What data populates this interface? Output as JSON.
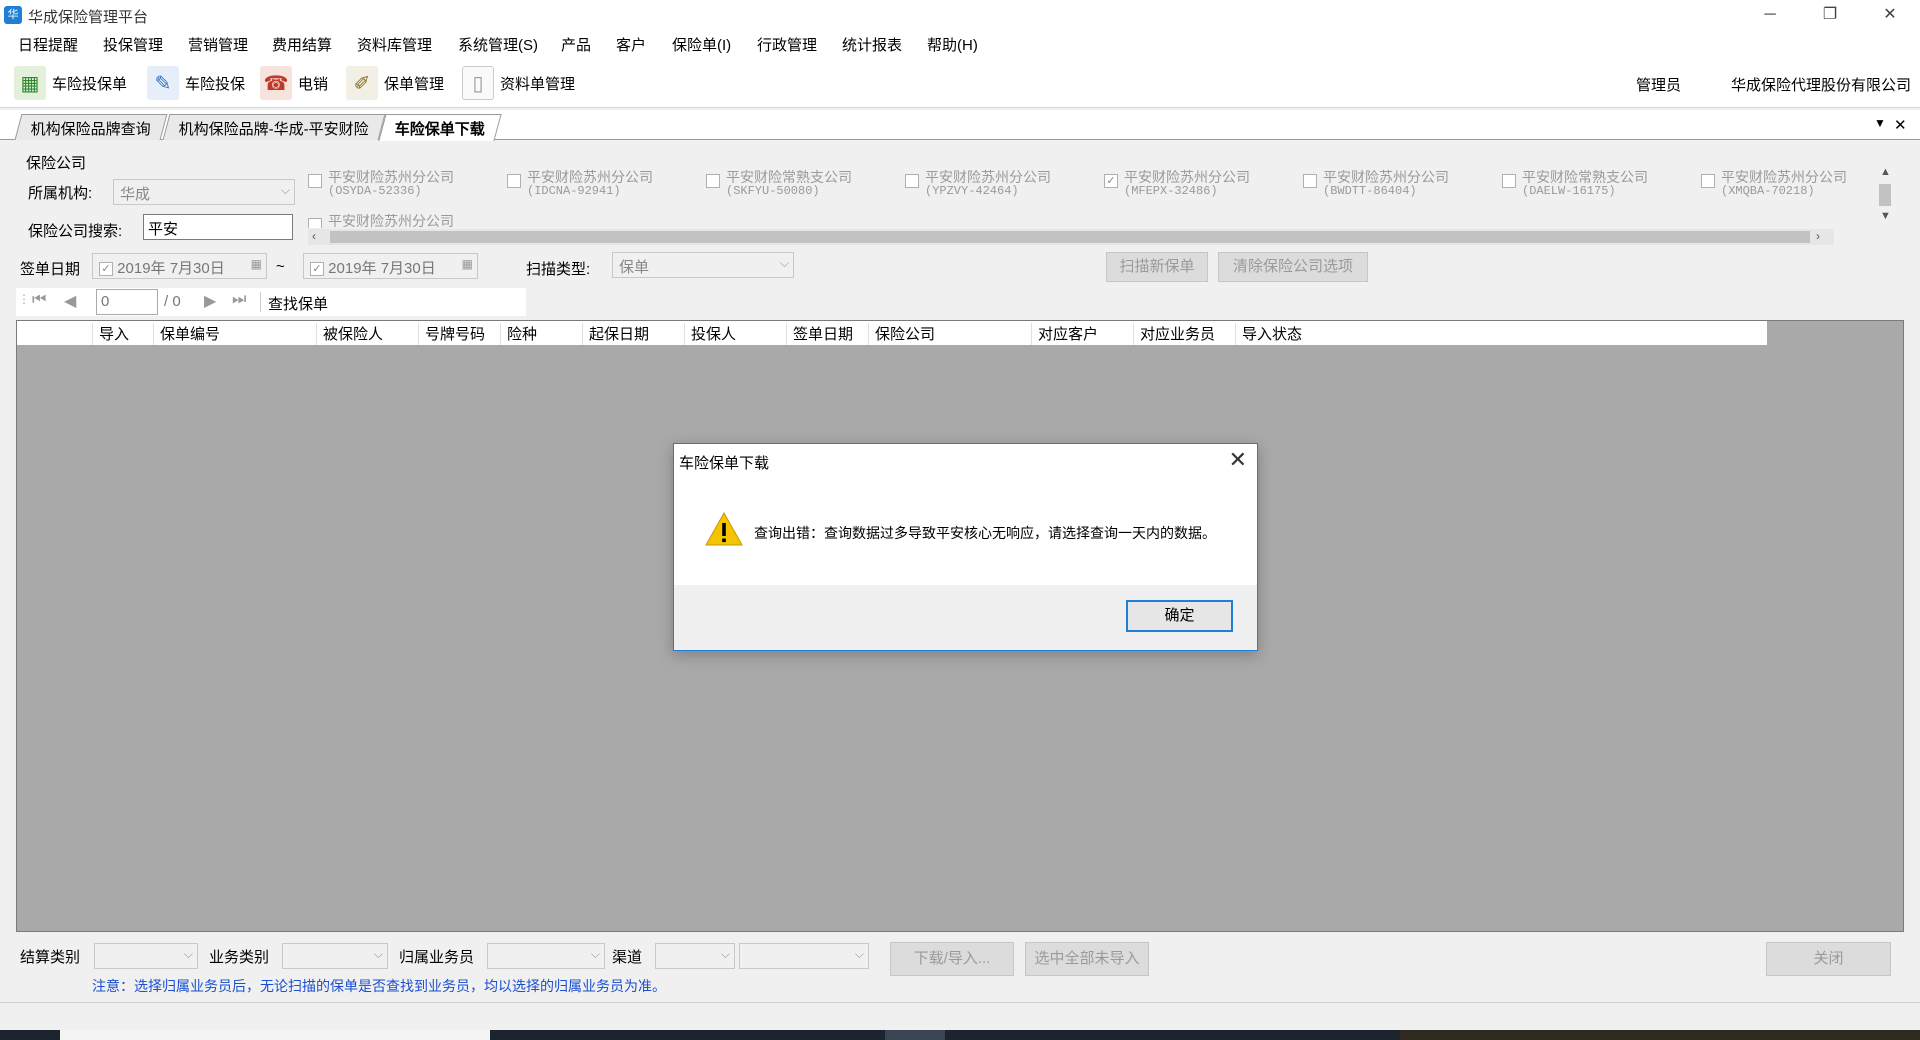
{
  "window": {
    "title": "华成保险管理平台",
    "controls": {
      "minimize": "─",
      "restore": "❐",
      "close": "✕"
    }
  },
  "menu": [
    "日程提醒",
    "投保管理",
    "营销管理",
    "费用结算",
    "资料库管理",
    "系统管理(S)",
    "产品",
    "客户",
    "保险单(I)",
    "行政管理",
    "统计报表",
    "帮助(H)"
  ],
  "toolbar": {
    "buttons": [
      "车险投保单",
      "车险投保",
      "电销",
      "保单管理",
      "资料单管理"
    ],
    "user": "管理员",
    "company": "华成保险代理股份有限公司"
  },
  "tabs": [
    "机构保险品牌查询",
    "机构保险品牌-华成-平安财险",
    "车险保单下载"
  ],
  "form": {
    "group_label": "保险公司",
    "org_label": "所属机构:",
    "org_value": "华成",
    "search_label": "保险公司搜索:",
    "search_value": "平安",
    "companies": [
      {
        "name": "平安财险苏州分公司",
        "code": "(OSYDA-52336)",
        "checked": false
      },
      {
        "name": "平安财险苏州分公司",
        "code": "(IDCNA-92941)",
        "checked": false
      },
      {
        "name": "平安财险常熟支公司",
        "code": "(SKFYU-50080)",
        "checked": false
      },
      {
        "name": "平安财险苏州分公司",
        "code": "(YPZVY-42464)",
        "checked": false
      },
      {
        "name": "平安财险苏州分公司",
        "code": "(MFEPX-32486)",
        "checked": true
      },
      {
        "name": "平安财险苏州分公司",
        "code": "(BWDTT-86404)",
        "checked": false
      },
      {
        "name": "平安财险常熟支公司",
        "code": "(DAELW-16175)",
        "checked": false
      },
      {
        "name": "平安财险苏州分公司",
        "code": "(XMQBA-70218)",
        "checked": false
      }
    ],
    "partial_company": "平安财险苏州分公司",
    "date_label": "签单日期",
    "date_from": "2019年  7月30日",
    "date_sep": "~",
    "date_to": "2019年  7月30日",
    "scan_label": "扫描类型:",
    "scan_value": "保单",
    "scan_button": "扫描新保单",
    "clear_button": "清除保险公司选项"
  },
  "pager": {
    "page_value": "0",
    "total": "/ 0",
    "find_label": "查找保单"
  },
  "grid": {
    "columns": [
      "导入",
      "保单编号",
      "被保险人",
      "号牌号码",
      "险种",
      "起保日期",
      "投保人",
      "签单日期",
      "保险公司",
      "对应客户",
      "对应业务员",
      "导入状态"
    ]
  },
  "footer": {
    "settle_label": "结算类别",
    "biz_label": "业务类别",
    "agent_label": "归属业务员",
    "channel_label": "渠道",
    "download_button": "下载/导入...",
    "select_all_button": "选中全部未导入",
    "close_button": "关闭",
    "note": "注意：选择归属业务员后，无论扫描的保单是否查找到业务员，均以选择的归属业务员为准。"
  },
  "dialog": {
    "title": "车险保单下载",
    "close": "✕",
    "icon": "warning-icon",
    "message": "查询出错：查询数据过多导致平安核心无响应，请选择查询一天内的数据。",
    "ok": "确定"
  },
  "colors": {
    "accent": "#1e7fd8",
    "grid_bg": "#a9a9a9",
    "note": "#1a4fd0",
    "warning": "#f5c400"
  }
}
